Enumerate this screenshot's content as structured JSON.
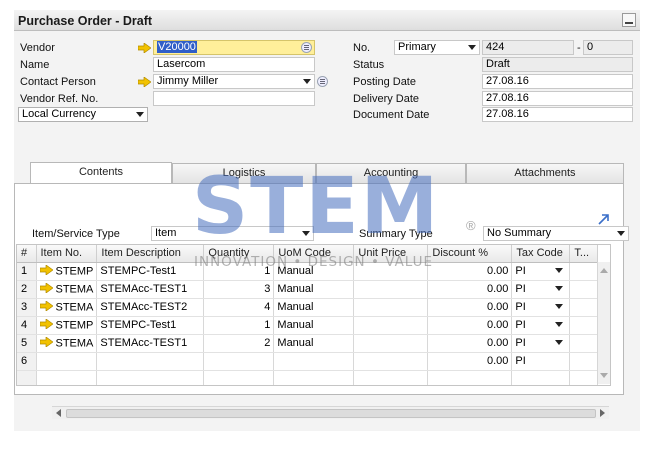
{
  "window": {
    "title": "Purchase Order - Draft"
  },
  "header": {
    "vendor_label": "Vendor",
    "vendor_value": "V20000",
    "name_label": "Name",
    "name_value": "Lasercom",
    "contact_label": "Contact Person",
    "contact_value": "Jimmy Miller",
    "vendor_ref_label": "Vendor Ref. No.",
    "vendor_ref_value": "",
    "currency_value": "Local Currency",
    "no_label": "No.",
    "series_value": "Primary",
    "doc_number": "424",
    "doc_suffix_sep": "-",
    "doc_suffix": "0",
    "status_label": "Status",
    "status_value": "Draft",
    "posting_label": "Posting Date",
    "posting_value": "27.08.16",
    "delivery_label": "Delivery Date",
    "delivery_value": "27.08.16",
    "document_label": "Document Date",
    "document_value": "27.08.16"
  },
  "tabs": [
    {
      "label": "Contents",
      "active": true
    },
    {
      "label": "Logistics",
      "active": false
    },
    {
      "label": "Accounting",
      "active": false
    },
    {
      "label": "Attachments",
      "active": false
    }
  ],
  "contents": {
    "item_type_label": "Item/Service Type",
    "item_type_value": "Item",
    "summary_type_label": "Summary Type",
    "summary_type_value": "No Summary"
  },
  "table": {
    "columns": [
      "#",
      "Item No.",
      "Item Description",
      "Quantity",
      "UoM Code",
      "Unit Price",
      "Discount %",
      "Tax Code",
      "T..."
    ],
    "rows": [
      {
        "num": "1",
        "item_no": "STEMP",
        "desc": "STEMPC-Test1",
        "qty": "1",
        "uom": "Manual",
        "price": "",
        "discount": "0.00",
        "tax": "PI"
      },
      {
        "num": "2",
        "item_no": "STEMA",
        "desc": "STEMAcc-TEST1",
        "qty": "3",
        "uom": "Manual",
        "price": "",
        "discount": "0.00",
        "tax": "PI"
      },
      {
        "num": "3",
        "item_no": "STEMA",
        "desc": "STEMAcc-TEST2",
        "qty": "4",
        "uom": "Manual",
        "price": "",
        "discount": "0.00",
        "tax": "PI"
      },
      {
        "num": "4",
        "item_no": "STEMP",
        "desc": "STEMPC-Test1",
        "qty": "1",
        "uom": "Manual",
        "price": "",
        "discount": "0.00",
        "tax": "PI"
      },
      {
        "num": "5",
        "item_no": "STEMA",
        "desc": "STEMAcc-TEST1",
        "qty": "2",
        "uom": "Manual",
        "price": "",
        "discount": "0.00",
        "tax": "PI"
      },
      {
        "num": "6",
        "item_no": "",
        "desc": "",
        "qty": "",
        "uom": "",
        "price": "",
        "discount": "0.00",
        "tax": "PI"
      }
    ]
  },
  "watermark": {
    "main": "STEM",
    "sub": "INNOVATION • DESIGN • VALUE",
    "reg": "®"
  },
  "colors": {
    "link_arrow": "#f2c200",
    "selection": "#2f5ec8",
    "selected_field": "#ffef9a"
  }
}
